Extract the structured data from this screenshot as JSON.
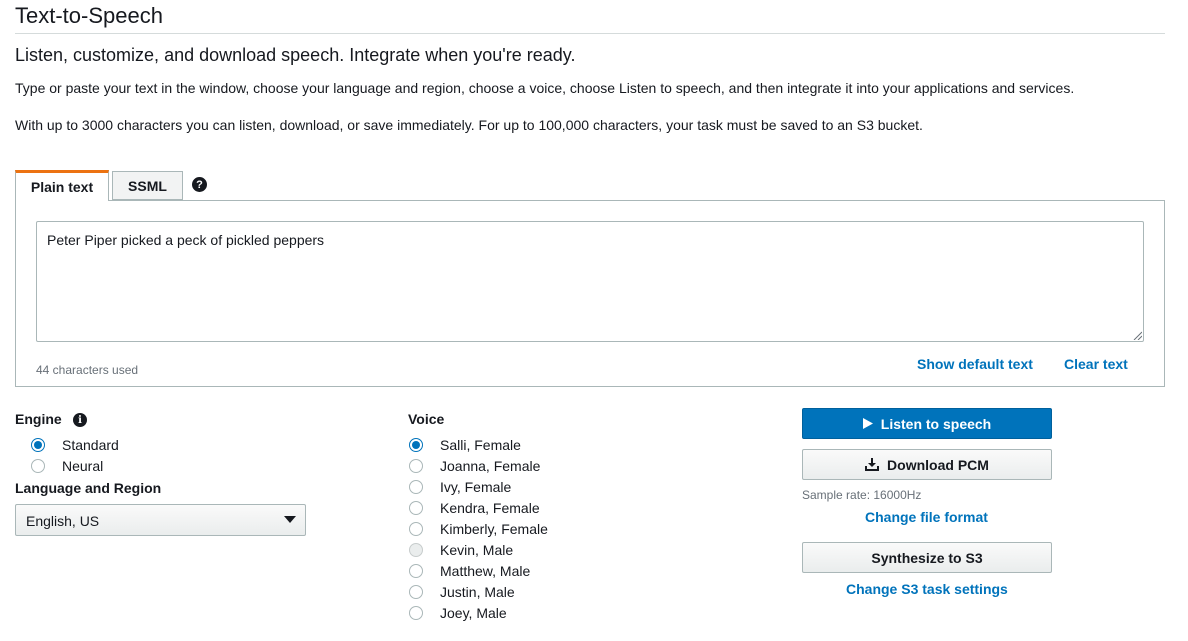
{
  "page": {
    "title": "Text-to-Speech",
    "subtitle": "Listen, customize, and download speech. Integrate when you're ready.",
    "intro": "Type or paste your text in the window, choose your language and region, choose a voice, choose Listen to speech, and then integrate it into your applications and services.",
    "limits": "With up to 3000 characters you can listen, download, or save immediately. For up to 100,000 characters, your task must be saved to an S3 bucket."
  },
  "tabs": {
    "plain_text": "Plain text",
    "ssml": "SSML",
    "active": "plain_text",
    "help_icon": "question-circle-icon"
  },
  "editor": {
    "value": "Peter Piper picked a peck of pickled peppers",
    "char_count": "44 characters used",
    "show_default_text": "Show default text",
    "clear_text": "Clear text"
  },
  "engine": {
    "label": "Engine",
    "info_icon": "info-icon",
    "options": [
      {
        "label": "Standard",
        "selected": true
      },
      {
        "label": "Neural",
        "selected": false
      }
    ]
  },
  "language": {
    "label": "Language and Region",
    "selected": "English, US"
  },
  "voice": {
    "label": "Voice",
    "options": [
      {
        "label": "Salli, Female",
        "selected": true
      },
      {
        "label": "Joanna, Female",
        "selected": false
      },
      {
        "label": "Ivy, Female",
        "selected": false
      },
      {
        "label": "Kendra, Female",
        "selected": false
      },
      {
        "label": "Kimberly, Female",
        "selected": false
      },
      {
        "label": "Kevin, Male",
        "selected": false
      },
      {
        "label": "Matthew, Male",
        "selected": false
      },
      {
        "label": "Justin, Male",
        "selected": false
      },
      {
        "label": "Joey, Male",
        "selected": false
      }
    ]
  },
  "actions": {
    "listen": "Listen to speech",
    "download": "Download PCM",
    "sample_rate": "Sample rate: 16000Hz",
    "change_file_format": "Change file format",
    "synthesize": "Synthesize to S3",
    "change_s3_settings": "Change S3 task settings"
  },
  "colors": {
    "accent": "#0073bb",
    "active_tab": "#ec7211"
  }
}
